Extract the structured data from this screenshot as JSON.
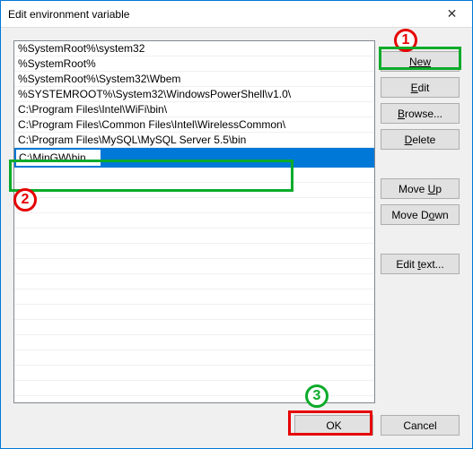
{
  "window": {
    "title": "Edit environment variable"
  },
  "list": {
    "items": [
      "%SystemRoot%\\system32",
      "%SystemRoot%",
      "%SystemRoot%\\System32\\Wbem",
      "%SYSTEMROOT%\\System32\\WindowsPowerShell\\v1.0\\",
      "C:\\Program Files\\Intel\\WiFi\\bin\\",
      "C:\\Program Files\\Common Files\\Intel\\WirelessCommon\\",
      "C:\\Program Files\\MySQL\\MySQL Server 5.5\\bin"
    ],
    "editing_value": "C:\\MinGW\\bin"
  },
  "buttons": {
    "new": "New",
    "edit": "Edit",
    "browse": "Browse...",
    "delete": "Delete",
    "move_up": "Move Up",
    "move_down": "Move Down",
    "edit_text": "Edit text...",
    "ok": "OK",
    "cancel": "Cancel"
  },
  "annotations": {
    "step1": "1",
    "step2": "2",
    "step3": "3"
  }
}
